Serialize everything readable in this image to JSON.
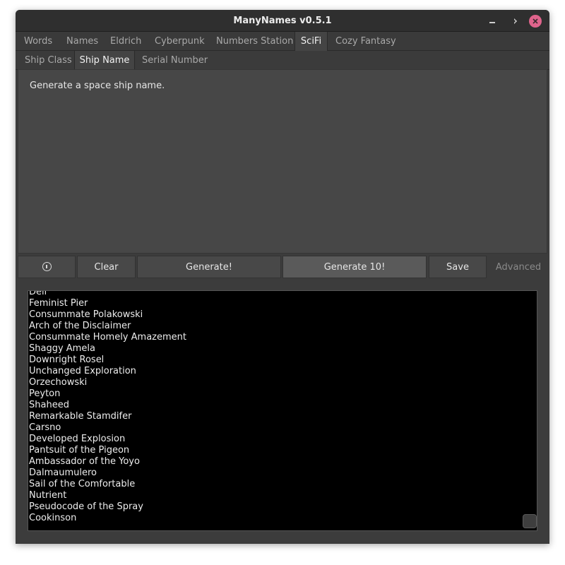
{
  "window": {
    "title": "ManyNames v0.5.1"
  },
  "top_tabs": [
    "Words",
    "Names",
    "Eldrich",
    "Cyberpunk",
    "Numbers Station",
    "SciFi",
    "Cozy Fantasy"
  ],
  "active_top_tab": "SciFi",
  "sub_tabs": [
    "Ship Class",
    "Ship Name",
    "Serial Number"
  ],
  "active_sub_tab": "Ship Name",
  "description": "Generate a space ship name.",
  "buttons": {
    "info_icon": "info-icon",
    "clear": "Clear",
    "generate": "Generate!",
    "generate10": "Generate 10!",
    "save": "Save",
    "advanced": "Advanced"
  },
  "results": [
    "Dell",
    "Feminist Pier",
    "Consummate Polakowski",
    "Arch of the Disclaimer",
    "Consummate Homely Amazement",
    "Shaggy Amela",
    "Downright Rosel",
    "Unchanged Exploration",
    "Orzechowski",
    "Peyton",
    "Shaheed",
    "Remarkable Stamdifer",
    "Carsno",
    "Developed Explosion",
    "Pantsuit of the Pigeon",
    "Ambassador of the Yoyo",
    "Dalmaumulero",
    "Sail of the Comfortable",
    "Nutrient",
    "Pseudocode of the Spray",
    "Cookinson"
  ],
  "colors": {
    "close_button": "#e0648c",
    "window_bg": "#3c3c3c",
    "output_bg": "#000000"
  }
}
